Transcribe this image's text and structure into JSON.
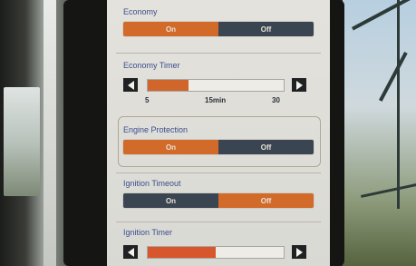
{
  "colors": {
    "active": "#d26a2a",
    "inactive": "#3b4552",
    "label": "#3c4e8c",
    "screen": "#dfddd7"
  },
  "economy": {
    "label": "Economy",
    "on_label": "On",
    "off_label": "Off",
    "selected": "On"
  },
  "economy_timer": {
    "label": "Economy Timer",
    "value_fraction": 0.3,
    "min_label": "5",
    "current_label": "15min",
    "max_label": "30",
    "left_icon": "arrow-left-icon",
    "right_icon": "arrow-right-icon"
  },
  "engine_protection": {
    "label": "Engine Protection",
    "on_label": "On",
    "off_label": "Off",
    "selected": "On"
  },
  "ignition_timeout": {
    "label": "Ignition Timeout",
    "on_label": "On",
    "off_label": "Off",
    "selected": "Off"
  },
  "ignition_timer": {
    "label": "Ignition Timer",
    "value_fraction": 0.5,
    "left_icon": "arrow-left-icon",
    "right_icon": "arrow-right-icon"
  }
}
